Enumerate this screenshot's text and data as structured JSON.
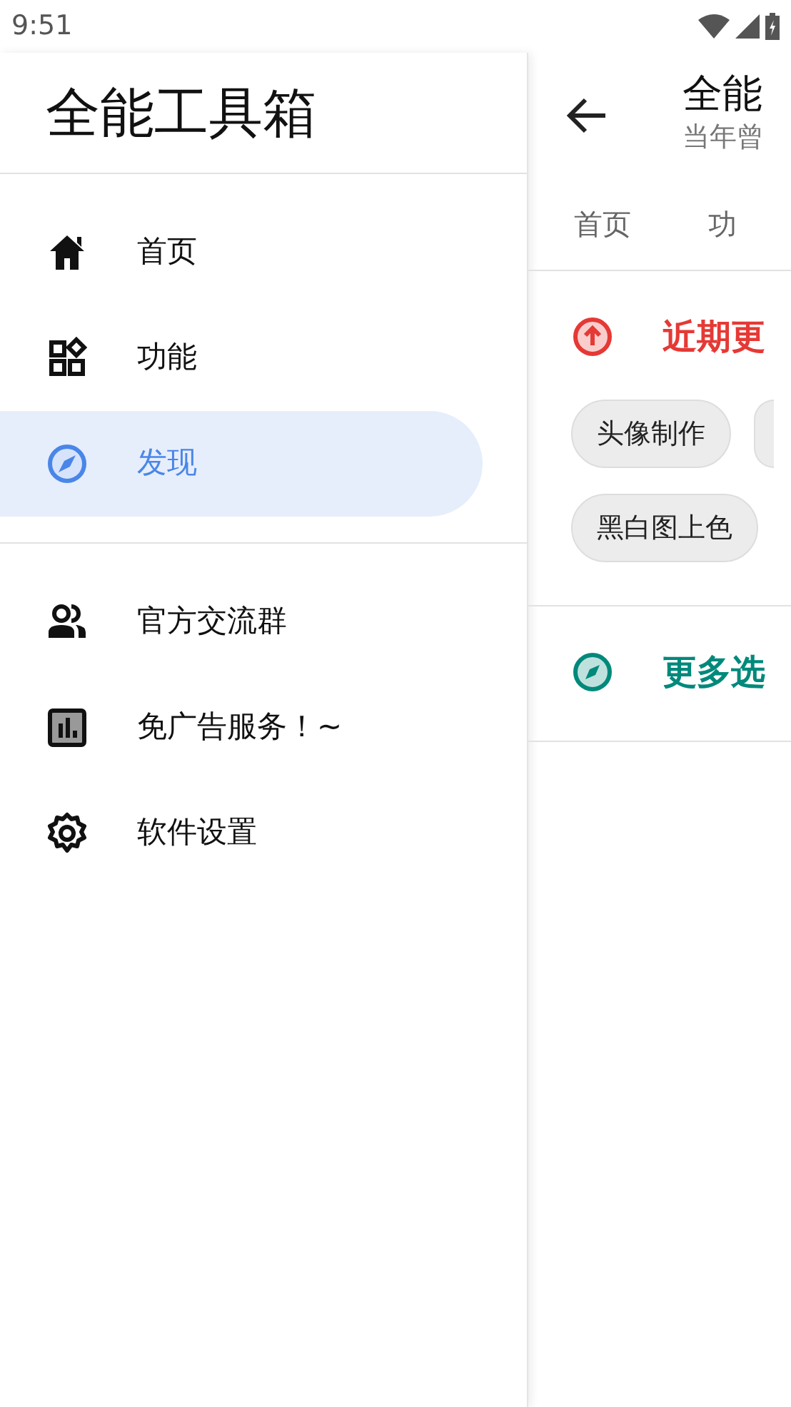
{
  "status_bar": {
    "time": "9:51"
  },
  "drawer": {
    "title": "全能工具箱",
    "groups": [
      {
        "items": [
          {
            "label": "首页",
            "selected": false
          },
          {
            "label": "功能",
            "selected": false
          },
          {
            "label": "发现",
            "selected": true
          }
        ]
      },
      {
        "items": [
          {
            "label": "官方交流群",
            "selected": false
          },
          {
            "label": "免广告服务！~",
            "selected": false
          },
          {
            "label": "软件设置",
            "selected": false
          }
        ]
      }
    ]
  },
  "page": {
    "title": "全能",
    "subtitle": "当年曾",
    "tabs": [
      "首页",
      "功"
    ],
    "sections": [
      {
        "title": "近期更",
        "color": "#e53935",
        "chips": [
          "头像制作",
          "黑白图上色"
        ]
      },
      {
        "title": "更多选",
        "color": "#00897b"
      }
    ]
  }
}
